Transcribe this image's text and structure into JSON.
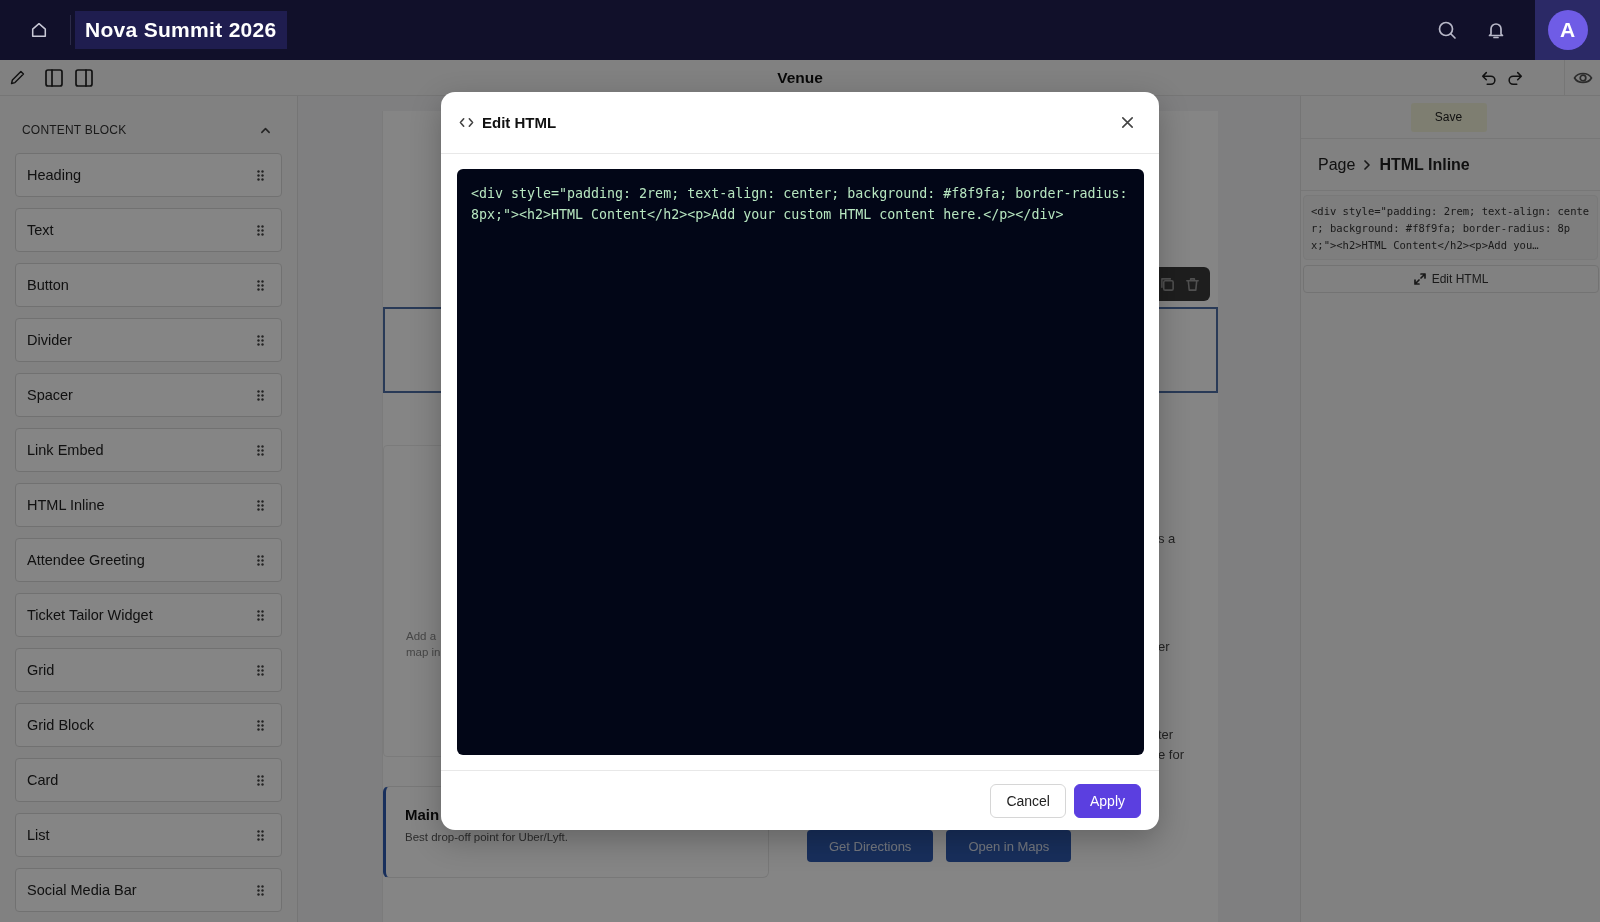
{
  "app_bar": {
    "title": "Nova Summit 2026",
    "avatar": "A"
  },
  "toolbar": {
    "page_title": "Venue"
  },
  "sidebar": {
    "section": "CONTENT BLOCK",
    "expanded": true,
    "items": [
      {
        "label": "Heading"
      },
      {
        "label": "Text"
      },
      {
        "label": "Button"
      },
      {
        "label": "Divider"
      },
      {
        "label": "Spacer"
      },
      {
        "label": "Link Embed"
      },
      {
        "label": "HTML Inline"
      },
      {
        "label": "Attendee Greeting"
      },
      {
        "label": "Ticket Tailor Widget"
      },
      {
        "label": "Grid"
      },
      {
        "label": "Grid Block"
      },
      {
        "label": "Card"
      },
      {
        "label": "List"
      },
      {
        "label": "Social Media Bar"
      }
    ]
  },
  "canvas": {
    "map_hint": [
      "Add a",
      "map in"
    ],
    "side_texts": [
      [
        "s a"
      ],
      [
        "er"
      ],
      [
        "ter",
        "e for"
      ]
    ],
    "location_card": {
      "title": "Main",
      "note": "Best drop-off point for Uber/Lyft."
    },
    "buttons": [
      "Get Directions",
      "Open in Maps"
    ]
  },
  "inspector": {
    "save": "Save",
    "breadcrumb": [
      "Page",
      "HTML Inline"
    ],
    "preview": "<div style=\"padding: 2rem; text-align: center; background: #f8f9fa; border-radius: 8px;\"><h2>HTML Content</h2><p>Add you…",
    "edit_button": "Edit HTML"
  },
  "modal": {
    "title": "Edit HTML",
    "code": "<div style=\"padding: 2rem; text-align: center; background: #f8f9fa; border-radius: 8px;\"><h2>HTML Content</h2><p>Add your custom HTML content here.</p></div>",
    "buttons": [
      {
        "label": "Cancel",
        "kind": "secondary"
      },
      {
        "label": "Apply",
        "kind": "primary"
      }
    ]
  }
}
